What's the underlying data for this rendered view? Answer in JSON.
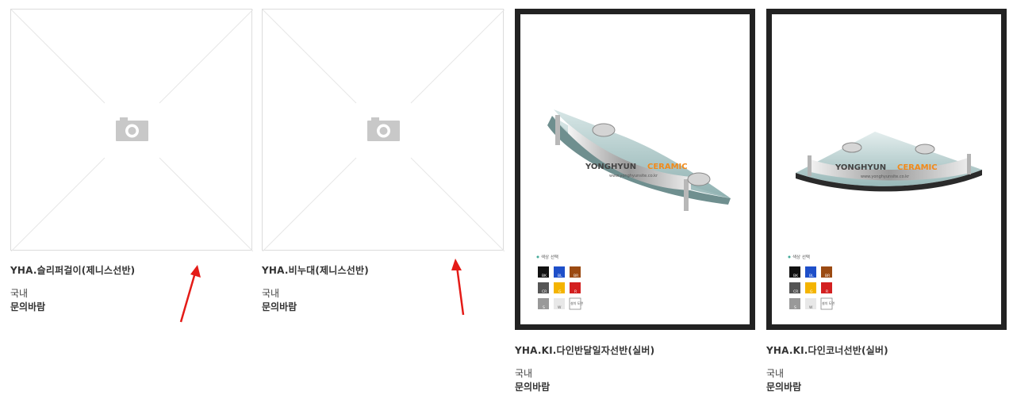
{
  "products": [
    {
      "name": "YHA.슬리퍼걸이(제니스선반)",
      "origin": "국내",
      "price": "문의바람",
      "image": "no-image-placeholder"
    },
    {
      "name": "YHA.비누대(제니스선반)",
      "origin": "국내",
      "price": "문의바람",
      "image": "no-image-placeholder"
    },
    {
      "name": "YHA.KI.다인반달일자선반(실버)",
      "origin": "국내",
      "price": "문의바람",
      "image": "half-moon-glass-shelf",
      "brand_prefix": "YONGHYUN",
      "brand_suffix": "CERAMIC",
      "brand_url": "www.yonghyunsite.co.kr",
      "color_label": "색상 선택",
      "color_chips": [
        "BK",
        "BL",
        "BR",
        "CR",
        "G",
        "R",
        "S",
        "W",
        "설치 도면"
      ]
    },
    {
      "name": "YHA.KI.다인코너선반(실버)",
      "origin": "국내",
      "price": "문의바람",
      "image": "corner-glass-shelf",
      "brand_prefix": "YONGHYUN",
      "brand_suffix": "CERAMIC",
      "brand_url": "www.yonghyunsite.co.kr",
      "color_label": "색상 선택",
      "color_chips": [
        "BK",
        "BL",
        "BR",
        "CR",
        "G",
        "R",
        "S",
        "W",
        "설치 도면"
      ]
    }
  ],
  "colors": {
    "annotation_arrow": "#e41b17",
    "frame": "#222222",
    "brand_orange": "#f28a1a"
  }
}
